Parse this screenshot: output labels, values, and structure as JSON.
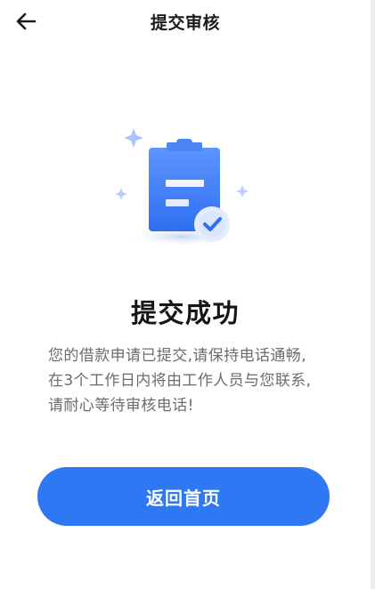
{
  "header": {
    "title": "提交审核"
  },
  "illustration": {
    "icon": "clipboard-check-icon",
    "colors": {
      "primary": "#2f78f3",
      "light": "#9fc0ff"
    }
  },
  "result": {
    "title": "提交成功",
    "description": "您的借款申请已提交,请保持电话通畅,在3个工作日内将由工作人员与您联系,请耐心等待审核电话!"
  },
  "actions": {
    "back_home_label": "返回首页"
  },
  "colors": {
    "accent": "#2f78f3",
    "text_primary": "#161616",
    "text_secondary": "#6c6c6c"
  }
}
